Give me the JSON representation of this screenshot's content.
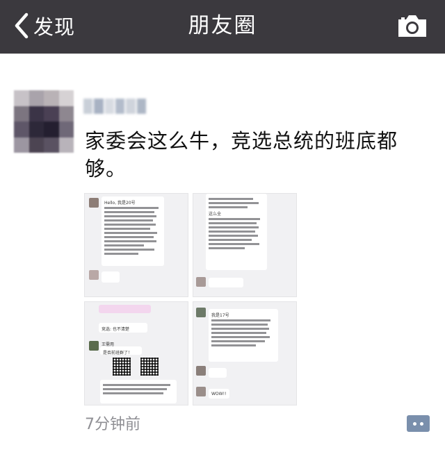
{
  "header": {
    "back_label": "发现",
    "title": "朋友圈"
  },
  "post": {
    "text": "家委会这么牛，竞选总统的班底都够。",
    "time": "7分钟前",
    "images": [
      {
        "label_a": "Hello, 我是20号"
      },
      {
        "label_a": "这么全"
      },
      {
        "label_a": "竞选: 也不清楚",
        "label_b": "王需用",
        "label_c": "是否前班群了！"
      },
      {
        "label_a": "我是17号",
        "label_b": "WOW!!"
      }
    ]
  },
  "colors": {
    "topbar": "#3b393e",
    "comment_button": "#7a8fac",
    "time_text": "#8f8f94"
  },
  "icons": [
    "chevron-left-icon",
    "camera-icon",
    "comment-icon"
  ]
}
